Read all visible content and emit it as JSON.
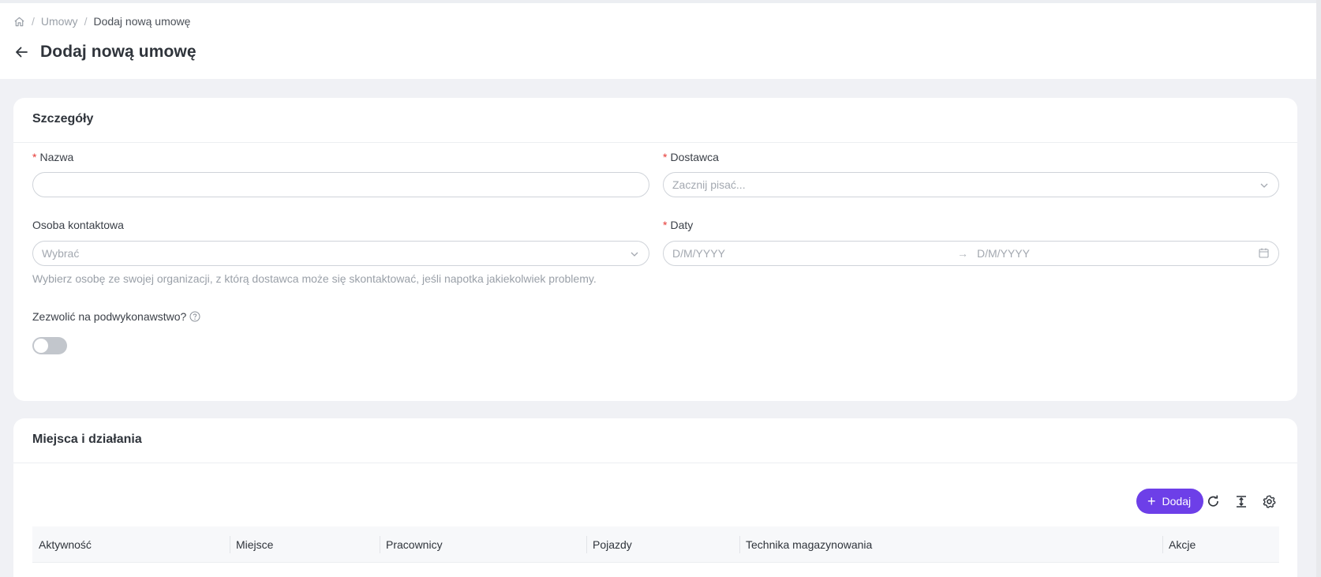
{
  "breadcrumb": {
    "home_icon": "home-icon",
    "items": [
      "Umowy",
      "Dodaj nową umowę"
    ],
    "separator": "/"
  },
  "header": {
    "title": "Dodaj nową umowę",
    "back_icon": "arrow-left-icon"
  },
  "details": {
    "title": "Szczegóły",
    "required_mark": "*",
    "name": {
      "label": "Nazwa",
      "value": "",
      "placeholder": ""
    },
    "supplier": {
      "label": "Dostawca",
      "placeholder": "Zacznij pisać..."
    },
    "contact": {
      "label": "Osoba kontaktowa",
      "placeholder": "Wybrać",
      "hint": "Wybierz osobę ze swojej organizacji, z którą dostawca może się skontaktować, jeśli napotka jakiekolwiek problemy."
    },
    "dates": {
      "label": "Daty",
      "start_placeholder": "D/M/YYYY",
      "end_placeholder": "D/M/YYYY",
      "arrow": "→"
    },
    "subcontracting": {
      "label": "Zezwolić na podwykonawstwo?",
      "enabled": false
    }
  },
  "places": {
    "title": "Miejsca i działania",
    "add_label": "Dodaj",
    "columns": [
      "Aktywność",
      "Miejsce",
      "Pracownicy",
      "Pojazdy",
      "Technika magazynowania",
      "Akcje"
    ]
  },
  "colors": {
    "accent": "#6d3fe8",
    "required": "#e53935",
    "background": "#f0f1f5"
  }
}
